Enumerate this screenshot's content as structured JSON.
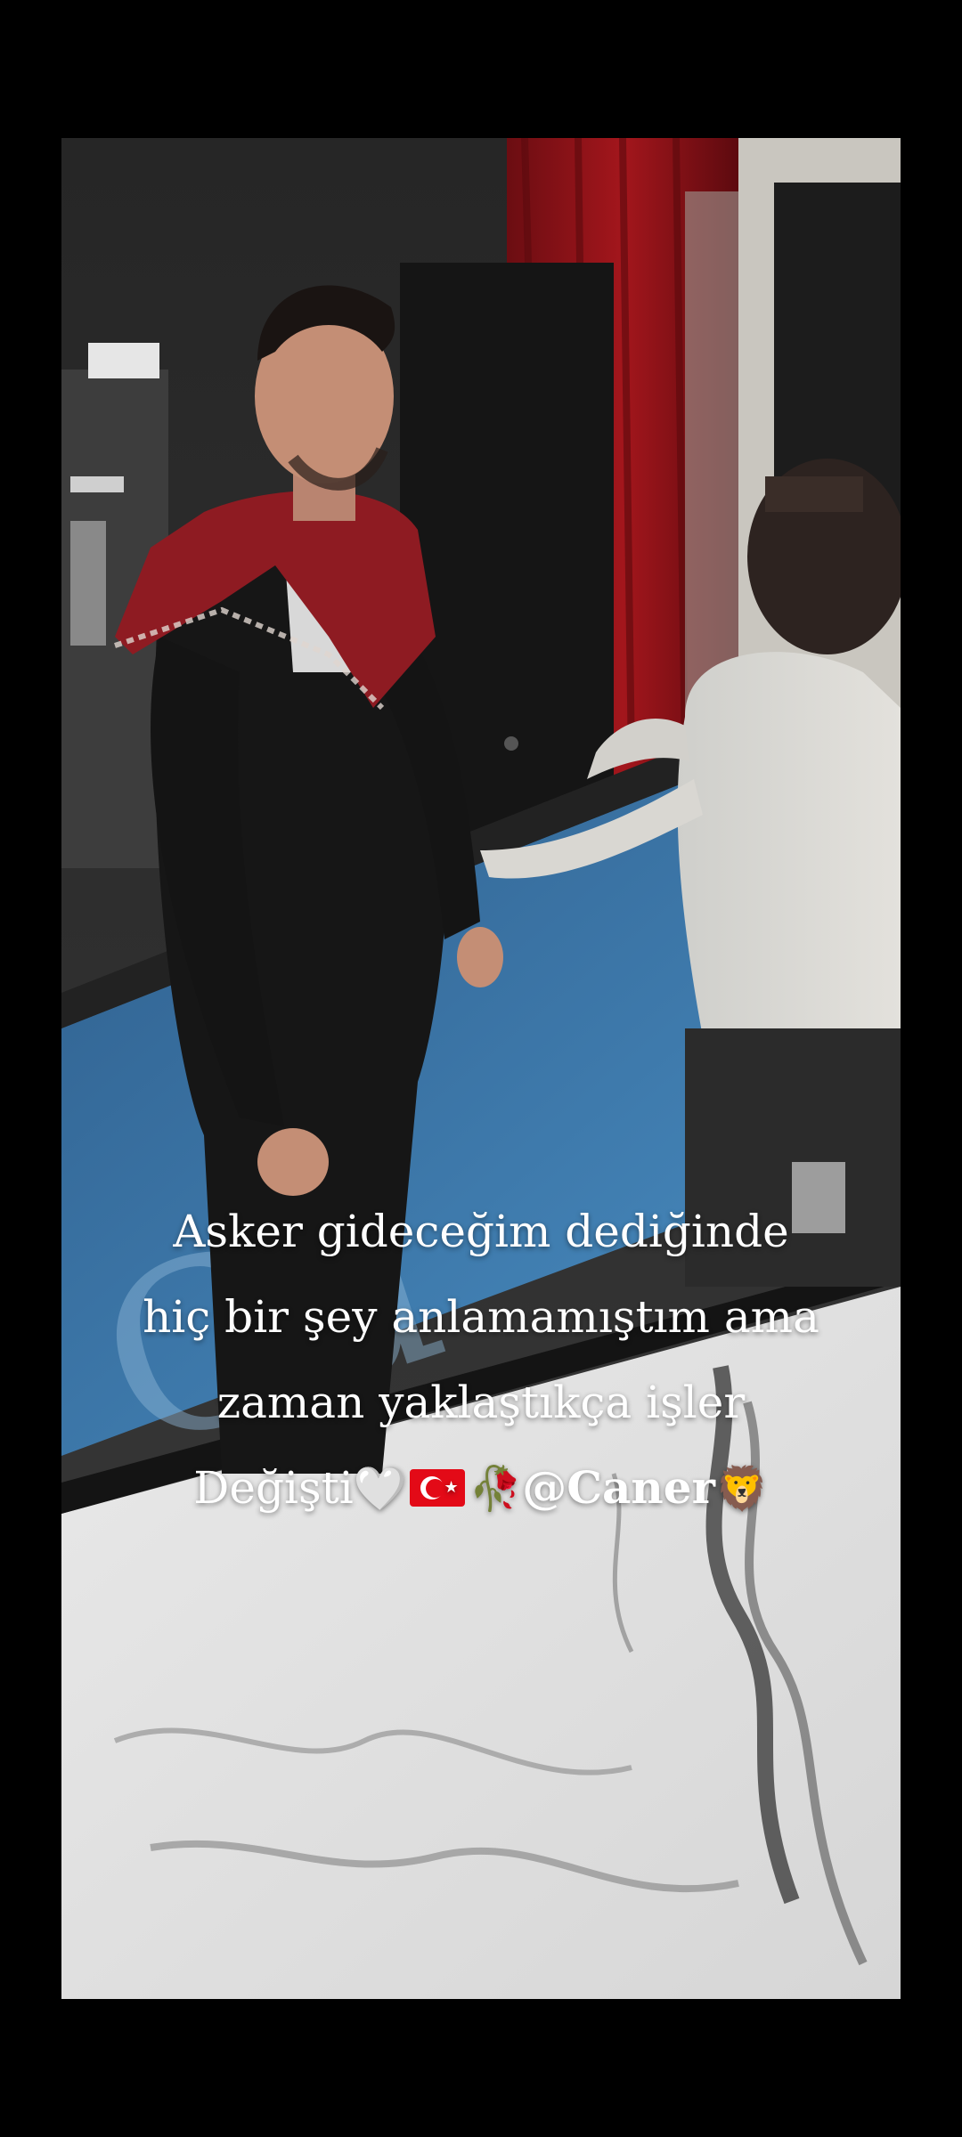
{
  "story": {
    "caption_lines": [
      "Asker gideceğim dediğinde",
      "hiç bir şey anlamamıştım  ama",
      "zaman yaklaştıkça işler"
    ],
    "caption_last_prefix": "Değişti",
    "emoji_heart": "🤍",
    "emoji_flag_star": "★",
    "emoji_rose": "🥀",
    "mention": "@Caner",
    "emoji_lion": "🦁"
  },
  "colors": {
    "background": "#000000",
    "caption_text": "#ffffff",
    "scarf_red": "#8e1b22",
    "sign_blue": "#3d7fb8",
    "curtain_red": "#a3161c"
  },
  "icons": {
    "heart": "white-heart-icon",
    "flag": "turkey-flag-icon",
    "rose": "wilted-rose-icon",
    "lion": "lion-face-icon"
  }
}
